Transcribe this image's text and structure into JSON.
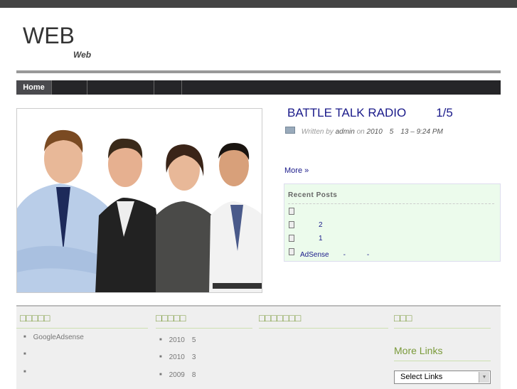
{
  "header": {
    "site_title": "WEB",
    "tagline": "Web"
  },
  "nav": {
    "items": [
      {
        "label": "Home"
      },
      {
        "label": ""
      },
      {
        "label": ""
      },
      {
        "label": ""
      },
      {
        "label": ""
      }
    ]
  },
  "post": {
    "title": "BATTLE TALK RADIO",
    "title_suffix": "1/5",
    "written_by": "Written by",
    "author": "admin",
    "on": "on",
    "date": "2010　5　13",
    "time": "– 9:24 PM",
    "more": "More »"
  },
  "recent_posts": {
    "heading": "Recent Posts",
    "items": [
      "",
      "2",
      "1",
      "AdSense　　-　　　-"
    ]
  },
  "footer": {
    "col1": {
      "heading": "□□□□□",
      "items": [
        "GoogleAdsense",
        "",
        ""
      ]
    },
    "col2": {
      "heading": "□□□□□",
      "items": [
        "2010　5",
        "2010　3",
        "2009　8"
      ]
    },
    "col3": {
      "heading": "□□□□□□□"
    },
    "col4": {
      "heading": "□□□",
      "more_links": "More Links",
      "select": "Select Links"
    }
  }
}
